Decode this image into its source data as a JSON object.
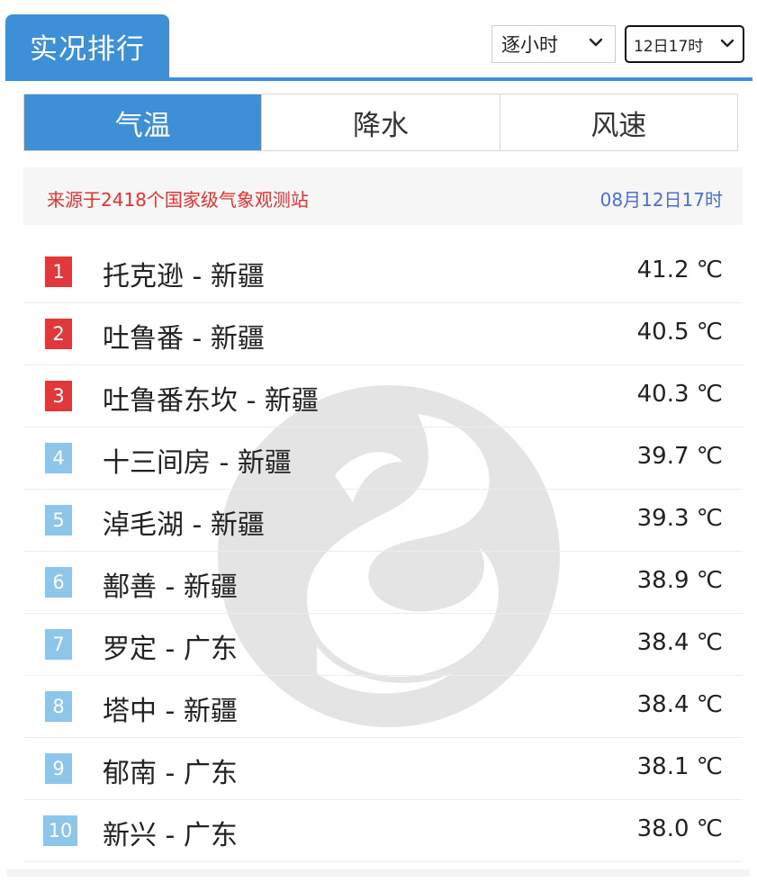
{
  "header": {
    "title": "实况排行"
  },
  "controls": {
    "hour_select": "逐小时",
    "time_select": "12日17时"
  },
  "tabs": [
    {
      "label": "气温",
      "active": true
    },
    {
      "label": "降水",
      "active": false
    },
    {
      "label": "风速",
      "active": false
    }
  ],
  "info": {
    "source": "来源于2418个国家级气象观测站",
    "date": "08月12日17时"
  },
  "ranking": [
    {
      "rank": "1",
      "name": "托克逊 - 新疆",
      "value": "41.2 ℃"
    },
    {
      "rank": "2",
      "name": "吐鲁番 - 新疆",
      "value": "40.5 ℃"
    },
    {
      "rank": "3",
      "name": "吐鲁番东坎 - 新疆",
      "value": "40.3 ℃"
    },
    {
      "rank": "4",
      "name": "十三间房 - 新疆",
      "value": "39.7 ℃"
    },
    {
      "rank": "5",
      "name": "淖毛湖 - 新疆",
      "value": "39.3 ℃"
    },
    {
      "rank": "6",
      "name": "鄯善 - 新疆",
      "value": "38.9 ℃"
    },
    {
      "rank": "7",
      "name": "罗定 - 广东",
      "value": "38.4 ℃"
    },
    {
      "rank": "8",
      "name": "塔中 - 新疆",
      "value": "38.4 ℃"
    },
    {
      "rank": "9",
      "name": "郁南 - 广东",
      "value": "38.1 ℃"
    },
    {
      "rank": "10",
      "name": "新兴 - 广东",
      "value": "38.0 ℃"
    }
  ],
  "colors": {
    "accent": "#3d8fd6",
    "rank_top": "#e0383b",
    "rank_rest": "#8ec5ea",
    "source_text": "#e8302f",
    "date_text": "#4b6ed6"
  },
  "icons": {
    "dropdown": "chevron-down-icon",
    "watermark": "weather-logo-watermark"
  }
}
